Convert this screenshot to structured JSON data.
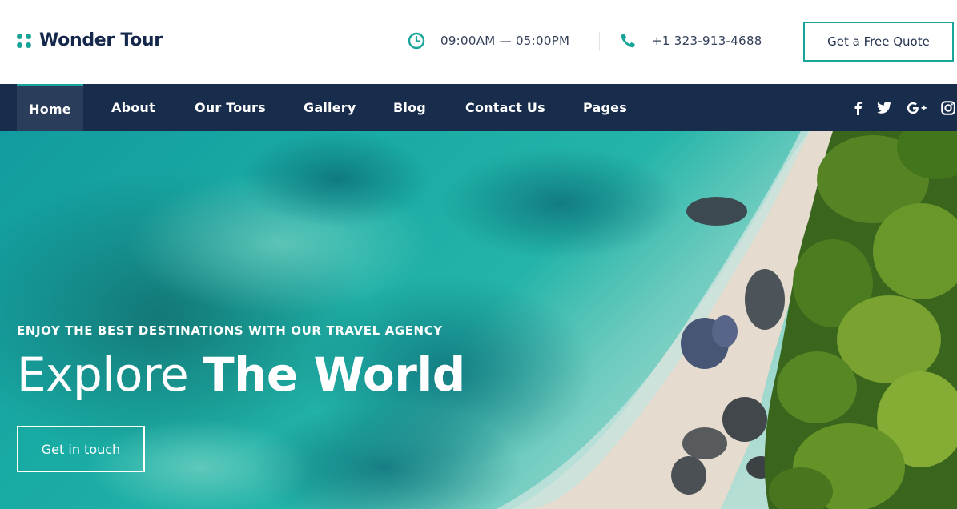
{
  "brand": {
    "name": "Wonder Tour"
  },
  "header": {
    "hours": "09:00AM — 05:00PM",
    "phone": "+1 323-913-4688",
    "quote_button": "Get a Free Quote"
  },
  "nav": {
    "items": [
      {
        "label": "Home",
        "active": true
      },
      {
        "label": "About"
      },
      {
        "label": "Our Tours"
      },
      {
        "label": "Gallery"
      },
      {
        "label": "Blog"
      },
      {
        "label": "Contact Us"
      },
      {
        "label": "Pages"
      }
    ],
    "social": [
      "facebook-icon",
      "twitter-icon",
      "google-plus-icon",
      "instagram-icon"
    ]
  },
  "hero": {
    "kicker": "ENJOY THE BEST DESTINATIONS WITH OUR TRAVEL AGENCY",
    "title_light": "Explore ",
    "title_bold": "The World",
    "cta": "Get in touch"
  },
  "colors": {
    "accent": "#1aa59a",
    "navbar": "#182c4b",
    "brand_text": "#15284b"
  }
}
